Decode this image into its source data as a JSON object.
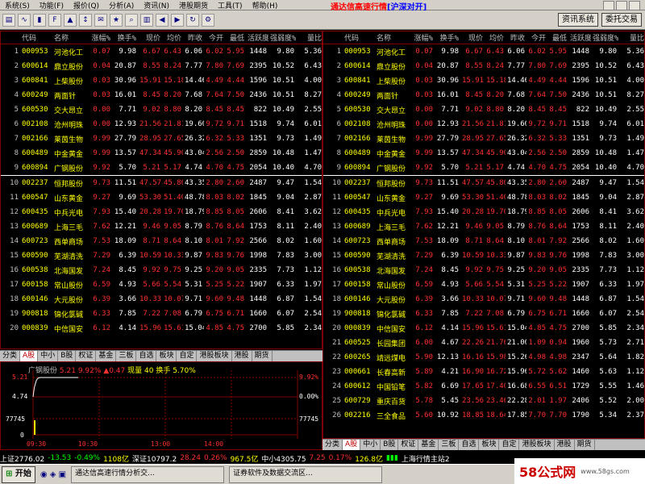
{
  "menu": [
    "系统(S)",
    "功能(F)",
    "报价(Q)",
    "分析(A)",
    "资讯(N)",
    "港股期货",
    "工具(T)",
    "帮助(H)"
  ],
  "app_title": "通达信高速行情",
  "app_title_suffix": "[沪深对开]",
  "toolbar_buttons": {
    "news": "资讯系统",
    "trade": "委托交易"
  },
  "columns": [
    "代码",
    "名称",
    "涨幅%",
    "换手%",
    "现价",
    "均价",
    "昨收",
    "今开",
    "最低",
    "活跃度",
    "强弱度%",
    "量比"
  ],
  "left_rows": [
    {
      "no": "1",
      "code": "000953",
      "name": "河池化工",
      "chg": "0.07",
      "turn": "9.98",
      "price": "6.67",
      "avg": "6.43",
      "prev": "6.06",
      "open": "6.02",
      "low": "5.95",
      "act": "1448",
      "str": "9.80",
      "vr": "5.36"
    },
    {
      "no": "2",
      "code": "600614",
      "name": "鼎立股份",
      "chg": "0.04",
      "turn": "20.87",
      "price": "8.55",
      "avg": "8.24",
      "prev": "7.77",
      "open": "7.80",
      "low": "7.69",
      "act": "2395",
      "str": "10.52",
      "vr": "6.43"
    },
    {
      "no": "3",
      "code": "600841",
      "name": "上柴股份",
      "chg": "0.03",
      "turn": "30.96",
      "price": "15.91",
      "avg": "15.18",
      "prev": "14.46",
      "open": "4.49",
      "low": "4.44",
      "act": "1596",
      "str": "10.51",
      "vr": "4.00"
    },
    {
      "no": "4",
      "code": "600249",
      "name": "两面针",
      "chg": "0.03",
      "turn": "16.01",
      "price": "8.45",
      "avg": "8.20",
      "prev": "7.68",
      "open": "7.64",
      "low": "7.50",
      "act": "2436",
      "str": "10.51",
      "vr": "8.27"
    },
    {
      "no": "5",
      "code": "600530",
      "name": "交大昂立",
      "chg": "0.00",
      "turn": "7.71",
      "price": "9.02",
      "avg": "8.80",
      "prev": "8.20",
      "open": "8.45",
      "low": "8.45",
      "act": "822",
      "str": "10.49",
      "vr": "2.55"
    },
    {
      "no": "6",
      "code": "002108",
      "name": "沧州明珠",
      "chg": "0.00",
      "turn": "12.93",
      "price": "21.56",
      "avg": "21.81",
      "prev": "19.60",
      "open": "9.72",
      "low": "9.71",
      "act": "1518",
      "str": "9.74",
      "vr": "6.01"
    },
    {
      "no": "7",
      "code": "002166",
      "name": "莱茵生物",
      "chg": "9.99",
      "turn": "27.79",
      "price": "28.95",
      "avg": "27.65",
      "prev": "26.32",
      "open": "6.32",
      "low": "5.33",
      "act": "1351",
      "str": "9.73",
      "vr": "1.49"
    },
    {
      "no": "8",
      "code": "600489",
      "name": "中金黄金",
      "chg": "9.99",
      "turn": "13.57",
      "price": "47.34",
      "avg": "45.90",
      "prev": "43.04",
      "open": "2.56",
      "low": "2.50",
      "act": "2859",
      "str": "10.48",
      "vr": "1.47"
    },
    {
      "no": "9",
      "code": "600894",
      "name": "广钢股份",
      "chg": "9.92",
      "turn": "5.70",
      "price": "5.21",
      "avg": "5.17",
      "prev": "4.74",
      "open": "4.70",
      "low": "4.75",
      "act": "2054",
      "str": "10.40",
      "vr": "4.70"
    },
    {
      "no": "10",
      "code": "002237",
      "name": "恒邦股份",
      "chg": "9.73",
      "turn": "11.51",
      "price": "47.57",
      "avg": "45.80",
      "prev": "43.35",
      "open": "2.80",
      "low": "2.60",
      "act": "2487",
      "str": "9.47",
      "vr": "1.54"
    },
    {
      "no": "11",
      "code": "600547",
      "name": "山东黄金",
      "chg": "9.27",
      "turn": "9.69",
      "price": "53.30",
      "avg": "51.40",
      "prev": "48.78",
      "open": "8.03",
      "low": "8.02",
      "act": "1845",
      "str": "9.04",
      "vr": "2.87"
    },
    {
      "no": "12",
      "code": "600435",
      "name": "中兵光电",
      "chg": "7.93",
      "turn": "15.40",
      "price": "20.28",
      "avg": "19.70",
      "prev": "18.79",
      "open": "8.85",
      "low": "8.05",
      "act": "2606",
      "str": "8.41",
      "vr": "3.62"
    },
    {
      "no": "13",
      "code": "600689",
      "name": "上海三毛",
      "chg": "7.62",
      "turn": "12.21",
      "price": "9.46",
      "avg": "9.05",
      "prev": "8.79",
      "open": "8.76",
      "low": "8.64",
      "act": "1753",
      "str": "8.11",
      "vr": "2.40"
    },
    {
      "no": "14",
      "code": "600723",
      "name": "西单商场",
      "chg": "7.53",
      "turn": "18.09",
      "price": "8.71",
      "avg": "8.64",
      "prev": "8.10",
      "open": "8.01",
      "low": "7.92",
      "act": "2566",
      "str": "8.02",
      "vr": "1.60"
    },
    {
      "no": "15",
      "code": "600590",
      "name": "芜湖清洗",
      "chg": "7.29",
      "turn": "6.39",
      "price": "10.59",
      "avg": "10.33",
      "prev": "9.87",
      "open": "9.83",
      "low": "9.76",
      "act": "1998",
      "str": "7.83",
      "vr": "3.00"
    },
    {
      "no": "16",
      "code": "600538",
      "name": "北海国发",
      "chg": "7.24",
      "turn": "8.45",
      "price": "9.92",
      "avg": "9.75",
      "prev": "9.25",
      "open": "9.20",
      "low": "9.05",
      "act": "2335",
      "str": "7.73",
      "vr": "1.12"
    },
    {
      "no": "17",
      "code": "600158",
      "name": "常山股份",
      "chg": "6.59",
      "turn": "4.93",
      "price": "5.66",
      "avg": "5.54",
      "prev": "5.31",
      "open": "5.25",
      "low": "5.22",
      "act": "1907",
      "str": "6.33",
      "vr": "1.97"
    },
    {
      "no": "18",
      "code": "600146",
      "name": "大元股份",
      "chg": "6.39",
      "turn": "3.66",
      "price": "10.33",
      "avg": "10.07",
      "prev": "9.71",
      "open": "9.60",
      "low": "9.48",
      "act": "1448",
      "str": "6.87",
      "vr": "1.54"
    },
    {
      "no": "19",
      "code": "900818",
      "name": "锦化氯碱",
      "chg": "6.33",
      "turn": "7.85",
      "price": "7.22",
      "avg": "7.08",
      "prev": "6.79",
      "open": "6.75",
      "low": "6.71",
      "act": "1660",
      "str": "6.07",
      "vr": "2.54"
    },
    {
      "no": "20",
      "code": "000839",
      "name": "中信国安",
      "chg": "6.12",
      "turn": "4.14",
      "price": "15.96",
      "avg": "15.61",
      "prev": "15.04",
      "open": "4.85",
      "low": "4.75",
      "act": "2700",
      "str": "5.85",
      "vr": "2.34"
    }
  ],
  "right_rows": [
    {
      "no": "1",
      "code": "000953",
      "name": "河池化工",
      "chg": "0.07",
      "turn": "9.98",
      "price": "6.67",
      "avg": "6.43",
      "prev": "6.06",
      "open": "6.02",
      "low": "5.95",
      "act": "1448",
      "str": "9.80",
      "vr": "5.36"
    },
    {
      "no": "2",
      "code": "600614",
      "name": "鼎立股份",
      "chg": "0.04",
      "turn": "20.87",
      "price": "8.55",
      "avg": "8.24",
      "prev": "7.77",
      "open": "7.80",
      "low": "7.69",
      "act": "2395",
      "str": "10.52",
      "vr": "6.43"
    },
    {
      "no": "3",
      "code": "600841",
      "name": "上柴股份",
      "chg": "0.03",
      "turn": "30.96",
      "price": "15.91",
      "avg": "15.18",
      "prev": "14.46",
      "open": "4.49",
      "low": "4.44",
      "act": "1596",
      "str": "10.51",
      "vr": "4.00"
    },
    {
      "no": "4",
      "code": "600249",
      "name": "两面针",
      "chg": "0.03",
      "turn": "16.01",
      "price": "8.45",
      "avg": "8.20",
      "prev": "7.68",
      "open": "7.64",
      "low": "7.50",
      "act": "2436",
      "str": "10.51",
      "vr": "8.27"
    },
    {
      "no": "5",
      "code": "600530",
      "name": "交大昂立",
      "chg": "0.00",
      "turn": "7.71",
      "price": "9.02",
      "avg": "8.80",
      "prev": "8.20",
      "open": "8.45",
      "low": "8.45",
      "act": "822",
      "str": "10.49",
      "vr": "2.55"
    },
    {
      "no": "6",
      "code": "002108",
      "name": "沧州明珠",
      "chg": "0.00",
      "turn": "12.93",
      "price": "21.56",
      "avg": "21.81",
      "prev": "19.60",
      "open": "9.72",
      "low": "9.71",
      "act": "1518",
      "str": "9.74",
      "vr": "6.01"
    },
    {
      "no": "7",
      "code": "002166",
      "name": "莱茵生物",
      "chg": "9.99",
      "turn": "27.79",
      "price": "28.95",
      "avg": "27.65",
      "prev": "26.32",
      "open": "6.32",
      "low": "5.33",
      "act": "1351",
      "str": "9.73",
      "vr": "1.49"
    },
    {
      "no": "8",
      "code": "600489",
      "name": "中金黄金",
      "chg": "9.99",
      "turn": "13.57",
      "price": "47.34",
      "avg": "45.90",
      "prev": "43.04",
      "open": "2.56",
      "low": "2.50",
      "act": "2859",
      "str": "10.48",
      "vr": "1.47"
    },
    {
      "no": "9",
      "code": "600894",
      "name": "广钢股份",
      "chg": "9.92",
      "turn": "5.70",
      "price": "5.21",
      "avg": "5.17",
      "prev": "4.74",
      "open": "4.70",
      "low": "4.75",
      "act": "2054",
      "str": "10.40",
      "vr": "4.70"
    },
    {
      "no": "10",
      "code": "002237",
      "name": "恒邦股份",
      "chg": "9.73",
      "turn": "11.51",
      "price": "47.57",
      "avg": "45.80",
      "prev": "43.35",
      "open": "2.80",
      "low": "2.60",
      "act": "2487",
      "str": "9.47",
      "vr": "1.54"
    },
    {
      "no": "11",
      "code": "600547",
      "name": "山东黄金",
      "chg": "9.27",
      "turn": "9.69",
      "price": "53.30",
      "avg": "51.40",
      "prev": "48.78",
      "open": "8.03",
      "low": "8.02",
      "act": "1845",
      "str": "9.04",
      "vr": "2.87"
    },
    {
      "no": "12",
      "code": "600435",
      "name": "中兵光电",
      "chg": "7.93",
      "turn": "15.40",
      "price": "20.28",
      "avg": "19.70",
      "prev": "18.79",
      "open": "8.85",
      "low": "8.05",
      "act": "2606",
      "str": "8.41",
      "vr": "3.62"
    },
    {
      "no": "13",
      "code": "600689",
      "name": "上海三毛",
      "chg": "7.62",
      "turn": "12.21",
      "price": "9.46",
      "avg": "9.05",
      "prev": "8.79",
      "open": "8.76",
      "low": "8.64",
      "act": "1753",
      "str": "8.11",
      "vr": "2.40"
    },
    {
      "no": "14",
      "code": "600723",
      "name": "西单商场",
      "chg": "7.53",
      "turn": "18.09",
      "price": "8.71",
      "avg": "8.64",
      "prev": "8.10",
      "open": "8.01",
      "low": "7.92",
      "act": "2566",
      "str": "8.02",
      "vr": "1.60"
    },
    {
      "no": "15",
      "code": "600590",
      "name": "芜湖清洗",
      "chg": "7.29",
      "turn": "6.39",
      "price": "10.59",
      "avg": "10.33",
      "prev": "9.87",
      "open": "9.83",
      "low": "9.76",
      "act": "1998",
      "str": "7.83",
      "vr": "3.00"
    },
    {
      "no": "16",
      "code": "600538",
      "name": "北海国发",
      "chg": "7.24",
      "turn": "8.45",
      "price": "9.92",
      "avg": "9.75",
      "prev": "9.25",
      "open": "9.20",
      "low": "9.05",
      "act": "2335",
      "str": "7.73",
      "vr": "1.12"
    },
    {
      "no": "17",
      "code": "600158",
      "name": "常山股份",
      "chg": "6.59",
      "turn": "4.93",
      "price": "5.66",
      "avg": "5.54",
      "prev": "5.31",
      "open": "5.25",
      "low": "5.22",
      "act": "1907",
      "str": "6.33",
      "vr": "1.97"
    },
    {
      "no": "18",
      "code": "600146",
      "name": "大元股份",
      "chg": "6.39",
      "turn": "3.66",
      "price": "10.33",
      "avg": "10.07",
      "prev": "9.71",
      "open": "9.60",
      "low": "9.48",
      "act": "1448",
      "str": "6.87",
      "vr": "1.54"
    },
    {
      "no": "19",
      "code": "900818",
      "name": "锦化氯碱",
      "chg": "6.33",
      "turn": "7.85",
      "price": "7.22",
      "avg": "7.08",
      "prev": "6.79",
      "open": "6.75",
      "low": "6.71",
      "act": "1660",
      "str": "6.07",
      "vr": "2.54"
    },
    {
      "no": "20",
      "code": "000839",
      "name": "中信国安",
      "chg": "6.12",
      "turn": "4.14",
      "price": "15.96",
      "avg": "15.61",
      "prev": "15.04",
      "open": "4.85",
      "low": "4.75",
      "act": "2700",
      "str": "5.85",
      "vr": "2.34"
    },
    {
      "no": "21",
      "code": "600525",
      "name": "长园集团",
      "chg": "6.00",
      "turn": "4.67",
      "price": "22.26",
      "avg": "21.76",
      "prev": "21.00",
      "open": "1.09",
      "low": "0.94",
      "act": "1960",
      "str": "5.73",
      "vr": "2.71"
    },
    {
      "no": "22",
      "code": "600265",
      "name": "靖远煤电",
      "chg": "5.90",
      "turn": "12.13",
      "price": "16.16",
      "avg": "15.98",
      "prev": "15.26",
      "open": "4.98",
      "low": "4.98",
      "act": "2347",
      "str": "5.64",
      "vr": "1.82"
    },
    {
      "no": "23",
      "code": "000661",
      "name": "长春高新",
      "chg": "5.89",
      "turn": "4.21",
      "price": "16.90",
      "avg": "16.72",
      "prev": "15.96",
      "open": "5.72",
      "low": "5.62",
      "act": "1460",
      "str": "5.63",
      "vr": "1.12"
    },
    {
      "no": "24",
      "code": "600612",
      "name": "中国铅笔",
      "chg": "5.82",
      "turn": "6.69",
      "price": "17.65",
      "avg": "17.40",
      "prev": "16.68",
      "open": "6.55",
      "low": "6.51",
      "act": "1729",
      "str": "5.55",
      "vr": "1.46"
    },
    {
      "no": "25",
      "code": "600729",
      "name": "重庆百货",
      "chg": "5.78",
      "turn": "5.45",
      "price": "23.56",
      "avg": "23.46",
      "prev": "22.28",
      "open": "2.01",
      "low": "1.97",
      "act": "2406",
      "str": "5.52",
      "vr": "2.00"
    },
    {
      "no": "26",
      "code": "002216",
      "name": "三全食品",
      "chg": "5.60",
      "turn": "10.92",
      "price": "18.85",
      "avg": "18.64",
      "prev": "17.85",
      "open": "7.70",
      "low": "7.70",
      "act": "1790",
      "str": "5.34",
      "vr": "2.37"
    }
  ],
  "tabs": [
    "分类",
    "A股",
    "中小",
    "B股",
    "权证",
    "基金",
    "三板",
    "自选",
    "板块",
    "自定",
    "港股板块",
    "港股",
    "期货"
  ],
  "mini_chart": {
    "stock": "广钢股份",
    "price": "5.21",
    "change": "9.92%",
    "delta": "▲0.47",
    "volume_label": "现量 40",
    "turnover": "换手 5.70%",
    "y_high": "5.21",
    "y_mid": "4.74",
    "pct_high": "9.92%",
    "pct_mid": "0.00%",
    "vol_label": "77745",
    "vol_zero": "0",
    "times": [
      "09:30",
      "10:30",
      "13:00",
      "14:00"
    ],
    "price_series": [
      4.74,
      4.95,
      5.05,
      5.14,
      5.18,
      5.2,
      5.21,
      5.21,
      5.21,
      5.21,
      5.21,
      5.21,
      5.21,
      5.21,
      5.21,
      5.21,
      5.21,
      5.21,
      5.21,
      5.21,
      5.21,
      5.21,
      5.21,
      5.21,
      5.21,
      5.21,
      5.21,
      5.21,
      5.21,
      5.21,
      5.21,
      5.21,
      5.21,
      5.21,
      5.21,
      5.21,
      5.21,
      5.21,
      5.21,
      5.21,
      5.21,
      5.21
    ]
  },
  "status": {
    "sh": "上证2776.02",
    "sh_chg": "-13.53",
    "sh_pct": "-0.49%",
    "sh_amt": "1108亿",
    "sz": "深证10797.2",
    "sz_chg": "28.24",
    "sz_pct": "0.26%",
    "sz_amt": "967.5亿",
    "zx": "中小4305.75",
    "zx_chg": "7.25",
    "zx_pct": "0.17%",
    "zx_amt": "126.8亿",
    "feed": "上海行情主站2"
  },
  "taskbar": {
    "start": "开始",
    "task1": "通达信高速行情分析交...",
    "task2": "证券软件及数据交流区..."
  },
  "watermark": {
    "text": "58公式网",
    "url": "www.58gs.com"
  }
}
